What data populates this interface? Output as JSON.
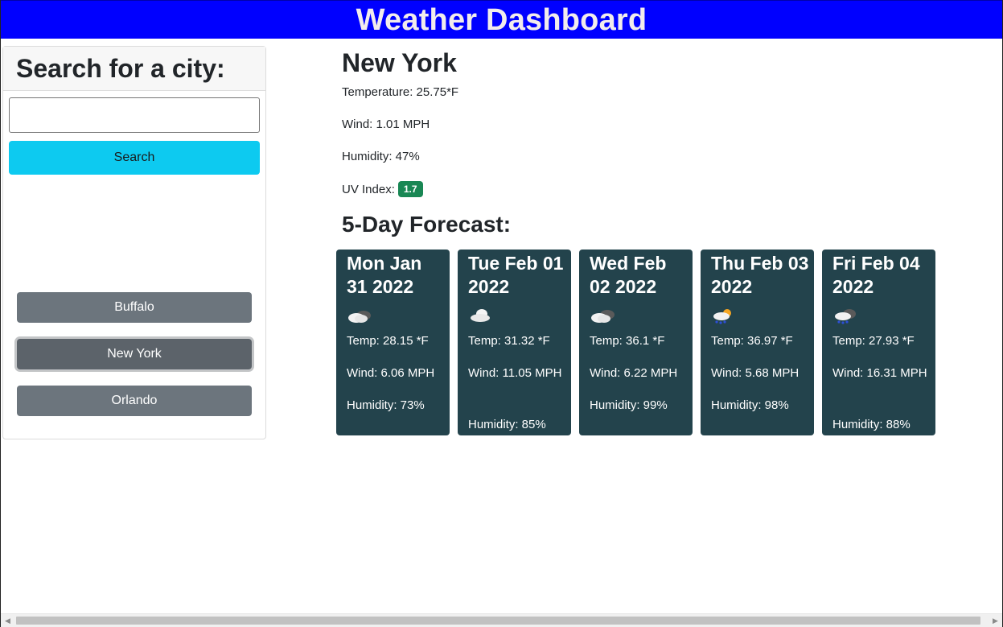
{
  "app": {
    "title": "Weather Dashboard",
    "header_color": "#0000ff"
  },
  "search": {
    "heading": "Search for a city:",
    "input_value": "",
    "button_label": "Search",
    "button_color": "#0dcaf0"
  },
  "history": [
    {
      "label": "Buffalo",
      "active": false
    },
    {
      "label": "New York",
      "active": true
    },
    {
      "label": "Orlando",
      "active": false
    }
  ],
  "current": {
    "city": "New York",
    "temperature": "Temperature: 25.75*F",
    "wind": "Wind: 1.01 MPH",
    "humidity": "Humidity: 47%",
    "uv_label": "UV Index:",
    "uv_value": "1.7",
    "uv_color": "#198754"
  },
  "forecast": {
    "title": "5-Day Forecast:",
    "card_color": "#23434c",
    "days": [
      {
        "date": "Mon Jan 31 2022",
        "icon": "partly-cloudy-night-icon",
        "temp": "Temp: 28.15 *F",
        "wind": "Wind: 6.06 MPH",
        "humidity": "Humidity: 73%"
      },
      {
        "date": "Tue Feb 01 2022",
        "icon": "cloud-icon",
        "temp": "Temp: 31.32 *F",
        "wind": "Wind: 11.05 MPH",
        "humidity": "Humidity: 85%"
      },
      {
        "date": "Wed Feb 02 2022",
        "icon": "broken-clouds-icon",
        "temp": "Temp: 36.1 *F",
        "wind": "Wind: 6.22 MPH",
        "humidity": "Humidity: 99%"
      },
      {
        "date": "Thu Feb 03 2022",
        "icon": "rain-sun-icon",
        "temp": "Temp: 36.97 *F",
        "wind": "Wind: 5.68 MPH",
        "humidity": "Humidity: 98%"
      },
      {
        "date": "Fri Feb 04 2022",
        "icon": "rain-cloud-icon",
        "temp": "Temp: 27.93 *F",
        "wind": "Wind: 16.31 MPH",
        "humidity": "Humidity: 88%"
      }
    ]
  }
}
